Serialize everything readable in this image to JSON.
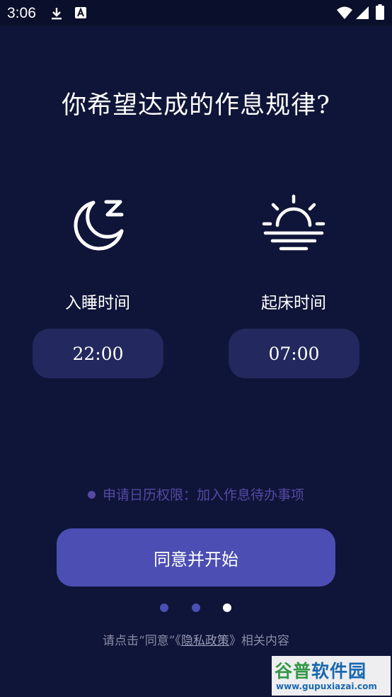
{
  "status_bar": {
    "time": "3:06",
    "icons": [
      "download-icon",
      "text-notification-icon",
      "wifi-icon",
      "signal-icon",
      "battery-icon"
    ]
  },
  "title": "你希望达成的作息规律?",
  "sleep": {
    "icon": "moon-sleep-icon",
    "label": "入睡时间",
    "time": "22:00"
  },
  "wake": {
    "icon": "sunrise-icon",
    "label": "起床时间",
    "time": "07:00"
  },
  "permission_text": "申请日历权限：加入作息待办事项",
  "cta_label": "同意并开始",
  "pager": {
    "total": 3,
    "active": 3
  },
  "footer": {
    "prefix": "请点击“同意”《",
    "link": "隐私政策",
    "suffix": "》相关内容"
  },
  "watermark": {
    "title_a": "谷普",
    "title_b": "软件园",
    "url": "www.gupuxiazai.com"
  },
  "colors": {
    "background": "#0f1538",
    "card": "#23295e",
    "accent": "#4c4eb3",
    "permission": "#5549a6"
  }
}
